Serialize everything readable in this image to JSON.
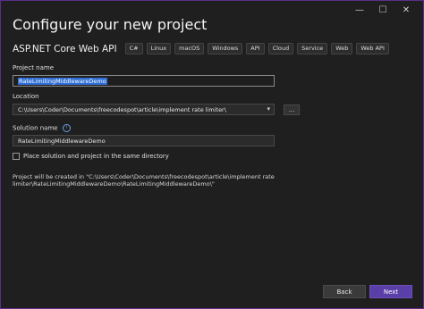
{
  "window": {
    "minimize_glyph": "—",
    "maximize_glyph": "☐",
    "close_glyph": "✕"
  },
  "header": {
    "title": "Configure your new project",
    "template_name": "ASP.NET Core Web API",
    "tags": [
      "C#",
      "Linux",
      "macOS",
      "Windows",
      "API",
      "Cloud",
      "Service",
      "Web",
      "Web API"
    ]
  },
  "form": {
    "project_name_label": "Project name",
    "project_name_value": "RateLimitingMiddlewareDemo",
    "location_label": "Location",
    "location_value": "C:\\Users\\Coder\\Documents\\freecodespot\\article\\implement rate limiter\\",
    "browse_label": "...",
    "solution_name_label": "Solution name",
    "solution_name_value": "RateLimitingMiddlewareDemo",
    "same_directory_label": "Place solution and project in the same directory",
    "same_directory_checked": false,
    "created_text": "Project will be created in \"C:\\Users\\Coder\\Documents\\freecodespot\\article\\implement rate limiter\\RateLimitingMiddlewareDemo\\RateLimitingMiddlewareDemo\\\""
  },
  "footer": {
    "back_label": "Back",
    "next_label": "Next"
  },
  "colors": {
    "background": "#1f1f1f",
    "accent": "#5b3fa8",
    "selection": "#2f6fd6"
  }
}
